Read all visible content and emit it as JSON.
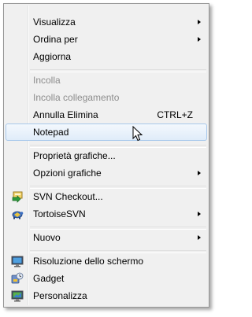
{
  "menu": {
    "items": [
      {
        "label": "Visualizza",
        "submenu": true
      },
      {
        "label": "Ordina per",
        "submenu": true
      },
      {
        "label": "Aggiorna"
      },
      {
        "label": "Incolla",
        "disabled": true
      },
      {
        "label": "Incolla collegamento",
        "disabled": true
      },
      {
        "label": "Annulla Elimina",
        "shortcut": "CTRL+Z"
      },
      {
        "label": "Notepad",
        "highlighted": true
      },
      {
        "label": "Proprietà grafiche..."
      },
      {
        "label": "Opzioni grafiche",
        "submenu": true
      },
      {
        "label": "SVN Checkout...",
        "icon": "svn-checkout-icon"
      },
      {
        "label": "TortoiseSVN",
        "icon": "tortoisesvn-icon",
        "submenu": true
      },
      {
        "label": "Nuovo",
        "submenu": true
      },
      {
        "label": "Risoluzione dello schermo",
        "icon": "screen-resolution-icon"
      },
      {
        "label": "Gadget",
        "icon": "gadget-icon"
      },
      {
        "label": "Personalizza",
        "icon": "personalize-icon"
      }
    ]
  },
  "colors": {
    "menu_background": "#f0f0f0",
    "highlight_border": "#a8c8eb",
    "disabled_text": "#8d8d8d"
  }
}
